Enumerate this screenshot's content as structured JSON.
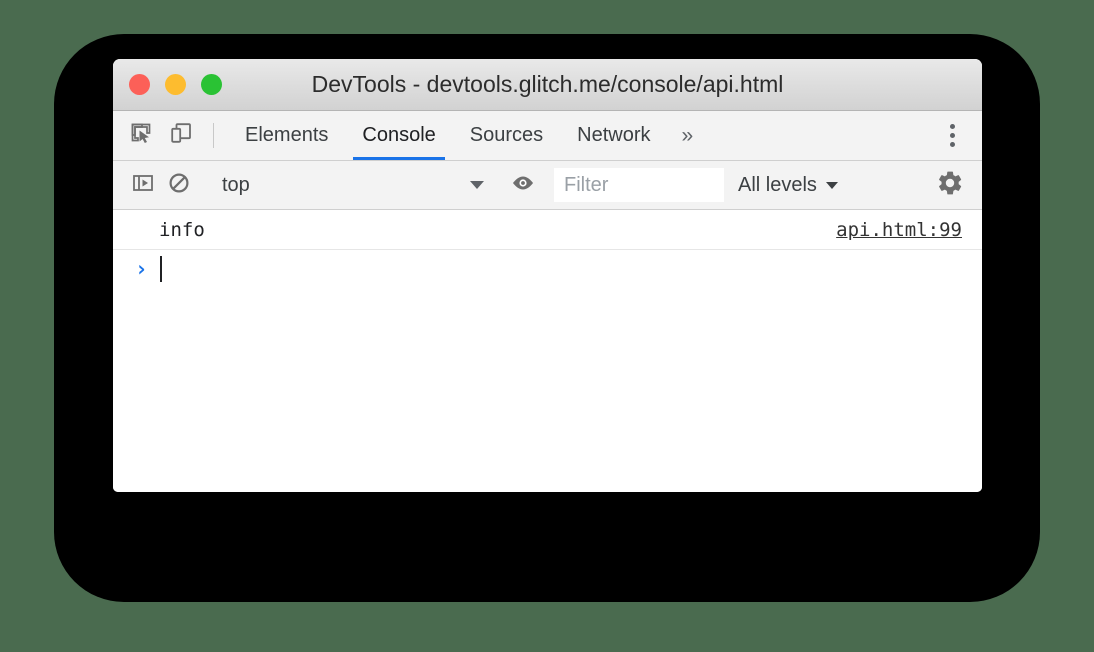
{
  "window": {
    "title": "DevTools - devtools.glitch.me/console/api.html",
    "traffic_lights": [
      {
        "name": "close",
        "color": "#fc6058"
      },
      {
        "name": "minimize",
        "color": "#fdbc2f"
      },
      {
        "name": "zoom",
        "color": "#2ac234"
      }
    ]
  },
  "tabbar": {
    "left_icons": [
      {
        "name": "inspect-element-icon",
        "title": "Inspect element"
      },
      {
        "name": "device-toolbar-icon",
        "title": "Toggle device toolbar"
      }
    ],
    "tabs": [
      {
        "label": "Elements",
        "selected": false
      },
      {
        "label": "Console",
        "selected": true
      },
      {
        "label": "Sources",
        "selected": false
      },
      {
        "label": "Network",
        "selected": false
      }
    ],
    "more_tabs_label": "»",
    "menu_label": "Customize and control DevTools"
  },
  "console_toolbar": {
    "sidebar_toggle": "console-sidebar-icon",
    "clear_console": "clear-console-icon",
    "context": {
      "value": "top",
      "caret": "chevron-down-icon"
    },
    "live_expression": "eye-icon",
    "filter": {
      "value": "",
      "placeholder": "Filter"
    },
    "levels": {
      "value": "All levels",
      "caret": "chevron-down-icon"
    },
    "settings": "gear-icon"
  },
  "console": {
    "messages": [
      {
        "text": "info",
        "source": "api.html:99"
      }
    ],
    "prompt": {
      "arrow": "›",
      "value": ""
    }
  },
  "colors": {
    "page_background": "#4a6b4f",
    "backdrop": "#000000",
    "accent": "#1a73e8",
    "toolbar_background": "#f3f3f3",
    "titlebar_background": "#dcdcdc"
  }
}
